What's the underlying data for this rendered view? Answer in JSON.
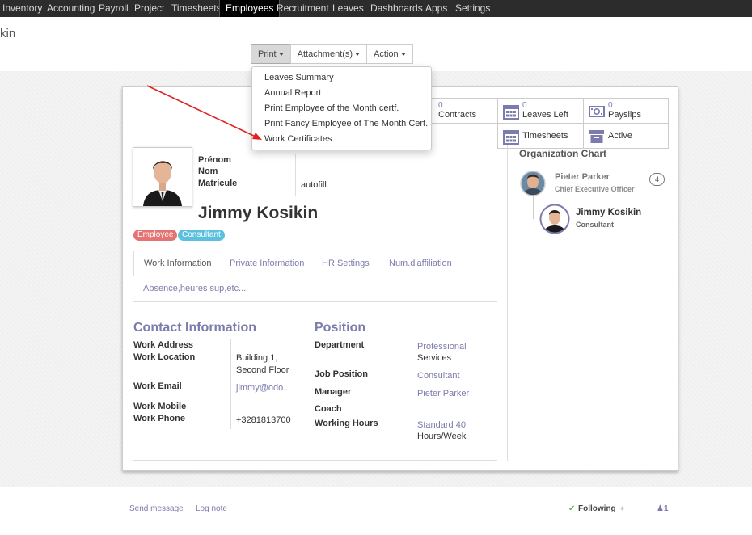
{
  "topnav": [
    "Inventory",
    "Accounting",
    "Payroll",
    "Project",
    "Timesheets",
    "Employees",
    "Recruitment",
    "Leaves",
    "Dashboards",
    "Apps",
    "Settings"
  ],
  "breadcrumb": "kin",
  "toolbar": {
    "print": "Print",
    "attachments": "Attachment(s)",
    "action": "Action"
  },
  "print_menu": [
    "Leaves Summary",
    "Annual Report",
    "Print Employee of the Month certf.",
    "Print Fancy Employee of The Month Cert.",
    "Work Certificates"
  ],
  "smart_buttons": {
    "contracts": {
      "count": "0",
      "label": "Contracts"
    },
    "leaves": {
      "count": "0",
      "label": "Leaves Left"
    },
    "payslips": {
      "count": "0",
      "label": "Payslips"
    },
    "timesheets": {
      "label": "Timesheets"
    },
    "active": {
      "label": "Active"
    }
  },
  "employee": {
    "labels": {
      "prenom": "Prénom",
      "nom": "Nom",
      "matricule": "Matricule"
    },
    "matricule_value": "autofill",
    "name": "Jimmy Kosikin",
    "tags": [
      {
        "label": "Employee",
        "color": "#e57373"
      },
      {
        "label": "Consultant",
        "color": "#5bc0de"
      }
    ]
  },
  "tabs": [
    "Work Information",
    "Private Information",
    "HR Settings",
    "Num.d'affiliation",
    "Absence,heures sup,etc..."
  ],
  "contact": {
    "title": "Contact Information",
    "work_address": "Work Address",
    "work_location": "Work Location",
    "location_value_1": "Building 1,",
    "location_value_2": "Second Floor",
    "work_email": "Work Email",
    "email_value": "jimmy@odo...",
    "work_mobile": "Work Mobile",
    "work_phone": "Work Phone",
    "phone_value": "+3281813700"
  },
  "position": {
    "title": "Position",
    "department": "Department",
    "department_value_1": "Professional",
    "department_value_2": "Services",
    "job_position": "Job Position",
    "job_value": "Consultant",
    "manager": "Manager",
    "manager_value": "Pieter Parker",
    "coach": "Coach",
    "working_hours": "Working Hours",
    "hours_value_1": "Standard 40",
    "hours_value_2": "Hours/Week"
  },
  "org_chart": {
    "title": "Organization Chart",
    "manager_name": "Pieter Parker",
    "manager_title": "Chief Executive Officer",
    "manager_count": "4",
    "self_name": "Jimmy Kosikin",
    "self_title": "Consultant"
  },
  "chatter": {
    "send": "Send message",
    "log": "Log note",
    "following": "Following",
    "followers": "1"
  },
  "colors": {
    "accent": "#7c7bad",
    "nav_bg": "#2c2c2c",
    "arrow": "#e02020"
  }
}
